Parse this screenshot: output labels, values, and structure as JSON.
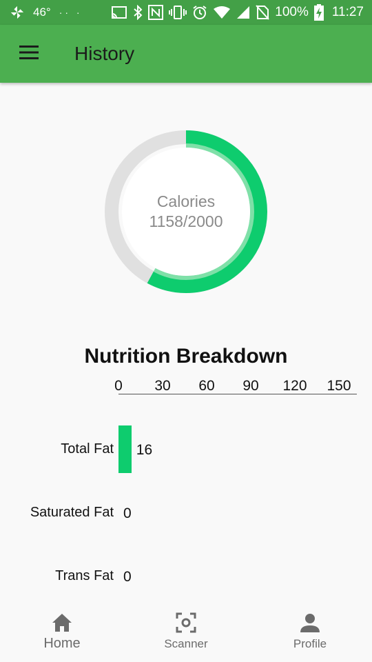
{
  "status_bar": {
    "temperature": "46°",
    "battery": "100%",
    "time": "11:27"
  },
  "app_bar": {
    "title": "History"
  },
  "calories": {
    "label": "Calories",
    "value_text": "1158/2000",
    "consumed": 1158,
    "goal": 2000,
    "colors": {
      "progress": "#0ecc6e",
      "track": "#e0e0e0"
    }
  },
  "nutrition": {
    "title": "Nutrition Breakdown",
    "axis_ticks": [
      "0",
      "30",
      "60",
      "90",
      "120",
      "150"
    ],
    "rows": [
      {
        "label": "Total Fat",
        "value": 16,
        "value_text": "16"
      },
      {
        "label": "Saturated Fat",
        "value": 0,
        "value_text": "0"
      },
      {
        "label": "Trans Fat",
        "value": 0,
        "value_text": "0"
      }
    ],
    "chart_data": {
      "type": "bar",
      "orientation": "horizontal",
      "categories": [
        "Total Fat",
        "Saturated Fat",
        "Trans Fat"
      ],
      "values": [
        16,
        0,
        0
      ],
      "title": "Nutrition Breakdown",
      "xlim": [
        0,
        150
      ],
      "bar_color": "#0ecc6e"
    }
  },
  "bottom_nav": {
    "items": [
      {
        "label": "Home",
        "icon": "home-icon",
        "active": true
      },
      {
        "label": "Scanner",
        "icon": "scanner-icon",
        "active": false
      },
      {
        "label": "Profile",
        "icon": "profile-icon",
        "active": false
      }
    ]
  },
  "colors": {
    "status_bar": "#43a047",
    "app_bar": "#4caf50",
    "accent": "#0ecc6e"
  }
}
